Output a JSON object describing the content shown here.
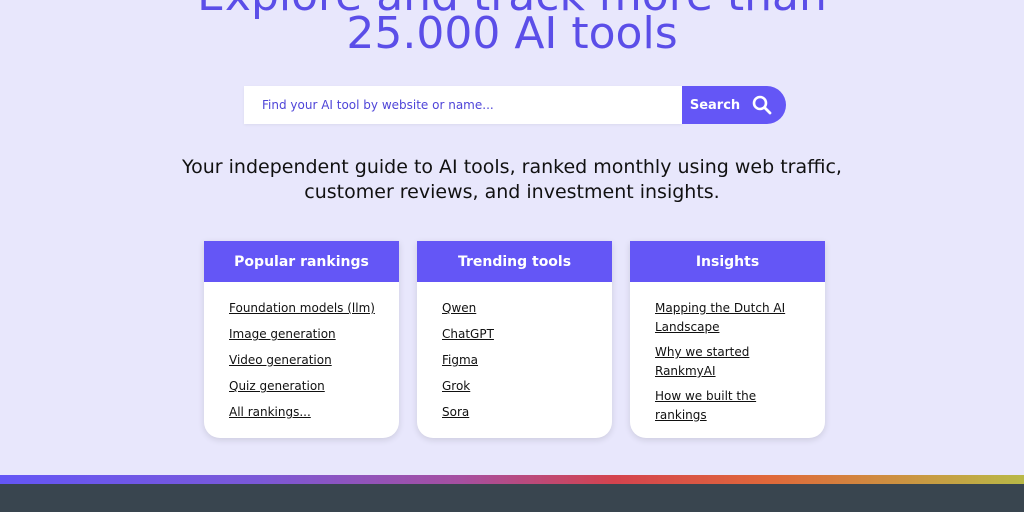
{
  "hero": {
    "line1": "Explore and track more than",
    "line2": "25.000 AI tools"
  },
  "search": {
    "placeholder": "Find your AI tool by website or name...",
    "button_label": "Search",
    "icon": "search-icon"
  },
  "tagline": {
    "line1": "Your independent guide to AI tools, ranked monthly using web traffic,",
    "line2": "customer reviews, and investment insights."
  },
  "cards": [
    {
      "title": "Popular rankings",
      "items": [
        "Foundation models (llm)",
        "Image generation",
        "Video generation",
        "Quiz generation",
        "All rankings..."
      ]
    },
    {
      "title": "Trending tools",
      "items": [
        "Qwen",
        "ChatGPT",
        "Figma",
        "Grok",
        "Sora"
      ]
    },
    {
      "title": "Insights",
      "items": [
        "Mapping the Dutch AI Landscape",
        "Why we started RankmyAI",
        "How we built the rankings"
      ]
    }
  ],
  "colors": {
    "accent": "#6456f6",
    "hero_text": "#5b4ee8",
    "background": "#e8e7fc",
    "footer": "#39454f"
  }
}
